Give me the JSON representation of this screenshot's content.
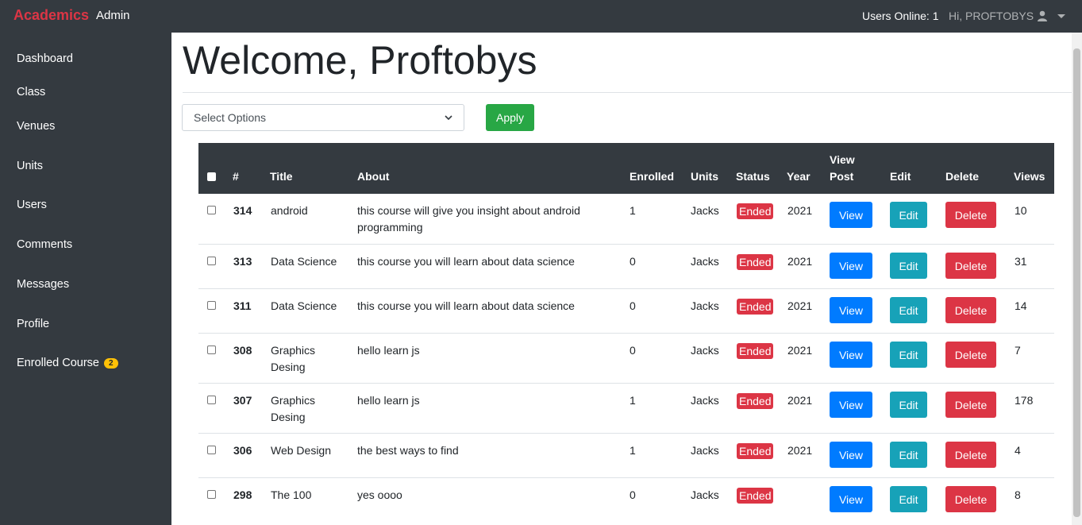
{
  "navbar": {
    "brand": "Academics",
    "brand_sub": "Admin",
    "users_online": "Users Online: 1",
    "user_greeting": "Hi, PROFTOBYS",
    "user_icon": "user-icon"
  },
  "sidebar": {
    "items": [
      {
        "label": "Dashboard"
      },
      {
        "label": "Class"
      },
      {
        "label": "Venues"
      },
      {
        "label": "Units"
      },
      {
        "label": "Users"
      },
      {
        "label": "Comments"
      },
      {
        "label": "Messages"
      },
      {
        "label": "Profile"
      },
      {
        "label": "Enrolled Course",
        "badge": "2"
      }
    ]
  },
  "main": {
    "title": "Welcome, Proftobys",
    "select_placeholder": "Select Options",
    "apply_label": "Apply"
  },
  "table": {
    "headers": {
      "num": "#",
      "title": "Title",
      "about": "About",
      "enrolled": "Enrolled",
      "units": "Units",
      "status": "Status",
      "year": "Year",
      "view_post_1": "View",
      "view_post_2": "Post",
      "edit": "Edit",
      "delete": "Delete",
      "views": "Views"
    },
    "rows": [
      {
        "id": "314",
        "title_1": "android",
        "title_2": "",
        "about_1": "this course will give you insight about android",
        "about_2": "programming",
        "enrolled": "1",
        "units": "Jacks",
        "status": "Ended",
        "year": "2021",
        "view": "View",
        "edit": "Edit",
        "delete": "Delete",
        "views": "10"
      },
      {
        "id": "313",
        "title_1": "Data Science",
        "title_2": "",
        "about_1": "this course you will learn about data science",
        "about_2": "",
        "enrolled": "0",
        "units": "Jacks",
        "status": "Ended",
        "year": "2021",
        "view": "View",
        "edit": "Edit",
        "delete": "Delete",
        "views": "31"
      },
      {
        "id": "311",
        "title_1": "Data Science",
        "title_2": "",
        "about_1": "this course you will learn about data science",
        "about_2": "",
        "enrolled": "0",
        "units": "Jacks",
        "status": "Ended",
        "year": "2021",
        "view": "View",
        "edit": "Edit",
        "delete": "Delete",
        "views": "14"
      },
      {
        "id": "308",
        "title_1": "Graphics",
        "title_2": "Desing",
        "about_1": "hello learn js",
        "about_2": "",
        "enrolled": "0",
        "units": "Jacks",
        "status": "Ended",
        "year": "2021",
        "view": "View",
        "edit": "Edit",
        "delete": "Delete",
        "views": "7"
      },
      {
        "id": "307",
        "title_1": "Graphics",
        "title_2": "Desing",
        "about_1": "hello learn js",
        "about_2": "",
        "enrolled": "1",
        "units": "Jacks",
        "status": "Ended",
        "year": "2021",
        "view": "View",
        "edit": "Edit",
        "delete": "Delete",
        "views": "178"
      },
      {
        "id": "306",
        "title_1": "Web Design",
        "title_2": "",
        "about_1": "the best ways to find",
        "about_2": "",
        "enrolled": "1",
        "units": "Jacks",
        "status": "Ended",
        "year": "2021",
        "view": "View",
        "edit": "Edit",
        "delete": "Delete",
        "views": "4"
      },
      {
        "id": "298",
        "title_1": "The 100",
        "title_2": "",
        "about_1": "yes oooo",
        "about_2": "",
        "enrolled": "0",
        "units": "Jacks",
        "status": "Ended",
        "year": "",
        "view": "View",
        "edit": "Edit",
        "delete": "Delete",
        "views": "8"
      }
    ]
  },
  "colors": {
    "navbar_bg": "#343a40",
    "brand": "#dc3545",
    "apply": "#28a745",
    "view_button": "#007bff",
    "edit_button": "#17a2b8",
    "delete_button": "#dc3545",
    "badge_warning": "#ffc107"
  }
}
